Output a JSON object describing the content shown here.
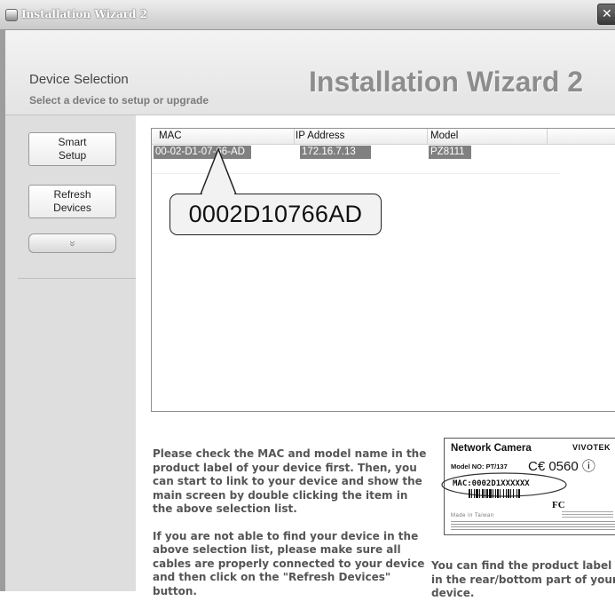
{
  "window": {
    "title": "Installation Wizard 2",
    "close_glyph": "✕"
  },
  "header": {
    "title": "Device Selection",
    "subtitle": "Select a device to setup or upgrade",
    "brand": "Installation Wizard 2"
  },
  "sidebar": {
    "smart_setup": {
      "line1": "Smart",
      "line2": "Setup"
    },
    "refresh_devices": {
      "line1": "Refresh",
      "line2": "Devices"
    },
    "more_glyph": "»"
  },
  "device_list": {
    "columns": [
      "MAC",
      "IP Address",
      "Model"
    ],
    "rows": [
      {
        "mac": "00-02-D1-07-66-AD",
        "ip": "172.16.7.13",
        "model": "PZ8111"
      }
    ],
    "selected_row_color": "#808080"
  },
  "callout": {
    "text": "0002D10766AD"
  },
  "instructions": {
    "para1": "Please check the MAC and model name in the product label of your device first. Then, you can start to link to your device and show the main screen by double clicking the item in the above selection list.",
    "para2": "If you are not able to find your device in the above selection list, please make sure all cables are properly connected to your device and then click on the \"Refresh Devices\" button."
  },
  "product_label": {
    "title": "Network Camera",
    "brand": "VIVOTEK",
    "model": "Model NO: PT/137",
    "cert": "C€ 0560 ⓘ",
    "mac": "MAC:0002D1XXXXXX",
    "fc": "FC",
    "made_in": "Made in Taiwan"
  },
  "label_caption": "You can find the product label in the rear/bottom part of your device."
}
